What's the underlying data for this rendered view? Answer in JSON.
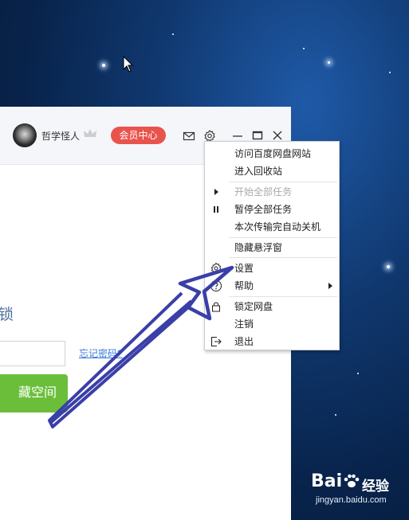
{
  "user": {
    "name": "哲学怪人"
  },
  "header": {
    "vip_label": "会员中心"
  },
  "lock_screen": {
    "title_fragment": "锁",
    "forgot_link": "忘记密码?",
    "enter_button_fragment": "藏空间"
  },
  "menu": {
    "items": [
      {
        "label": "访问百度网盘网站",
        "icon": "",
        "enabled": true
      },
      {
        "label": "进入回收站",
        "icon": "",
        "enabled": true
      },
      {
        "label": "开始全部任务",
        "icon": "play-icon",
        "enabled": false
      },
      {
        "label": "暂停全部任务",
        "icon": "pause-icon",
        "enabled": true
      },
      {
        "label": "本次传输完自动关机",
        "icon": "",
        "enabled": true
      },
      {
        "label": "隐藏悬浮窗",
        "icon": "",
        "enabled": true
      },
      {
        "label": "设置",
        "icon": "gear-icon",
        "enabled": true
      },
      {
        "label": "帮助",
        "icon": "help-icon",
        "enabled": true,
        "submenu": true
      },
      {
        "label": "锁定网盘",
        "icon": "lock-icon",
        "enabled": true
      },
      {
        "label": "注销",
        "icon": "",
        "enabled": true
      },
      {
        "label": "退出",
        "icon": "exit-icon",
        "enabled": true
      }
    ]
  },
  "watermark": {
    "logo": "Bai",
    "brand": "经验",
    "url": "jingyan.baidu.com"
  },
  "colors": {
    "vip": "#e9534d",
    "enter_button": "#6bbe3a",
    "link": "#3a7bd5",
    "arrow": "#3a3fa8"
  }
}
